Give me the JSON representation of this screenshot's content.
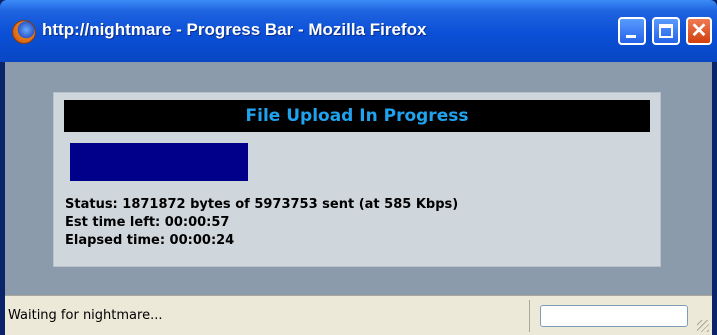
{
  "window": {
    "title": "http://nightmare - Progress Bar - Mozilla Firefox",
    "app_icon": "firefox-icon",
    "buttons": [
      "minimize-icon",
      "maximize-icon",
      "close-icon"
    ]
  },
  "panel": {
    "title": "File Upload In Progress",
    "progress_fraction": 0.313,
    "colors": {
      "header_bg": "#000000",
      "title": "#1fa3ee",
      "progress": "#00008b"
    },
    "status_line": "Status: 1871872 bytes of 5973753 sent (at 585 Kbps)",
    "time_left_line": "Est time left: 00:00:57",
    "elapsed_line": "Elapsed time: 00:00:24"
  },
  "statusbar": {
    "text": "Waiting for nightmare..."
  }
}
